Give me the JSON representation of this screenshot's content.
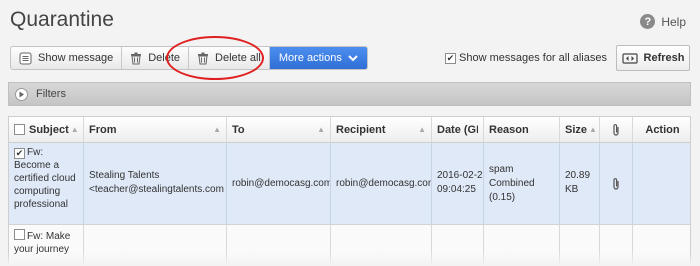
{
  "page": {
    "title": "Quarantine",
    "help_label": "Help"
  },
  "toolbar": {
    "show_message": "Show message",
    "delete": "Delete",
    "delete_all": "Delete all",
    "more_actions": "More actions"
  },
  "aliases": {
    "label": "Show messages for all aliases",
    "checked": true
  },
  "refresh_label": "Refresh",
  "filters_label": "Filters",
  "table": {
    "headers": {
      "subject": "Subject",
      "from": "From",
      "to": "To",
      "recipient": "Recipient",
      "date": "Date (GMT",
      "reason": "Reason",
      "size": "Size",
      "action": "Action"
    },
    "rows": [
      {
        "checked": true,
        "subject": "Fw: Become a certified cloud computing professional",
        "from_name": "Stealing Talents",
        "from_email": "<teacher@stealingtalents.com",
        "to": "robin@democasg.com",
        "recipient": "robin@democasg.com",
        "date_line1": "2016-02-2",
        "date_line2": "09:04:25",
        "reason_line1": "spam",
        "reason_line2": "Combined",
        "reason_line3": "(0.15)",
        "size_line1": "20.89",
        "size_line2": "KB",
        "has_attachment": true
      },
      {
        "checked": false,
        "subject": "Fw: Make your journey"
      }
    ]
  }
}
